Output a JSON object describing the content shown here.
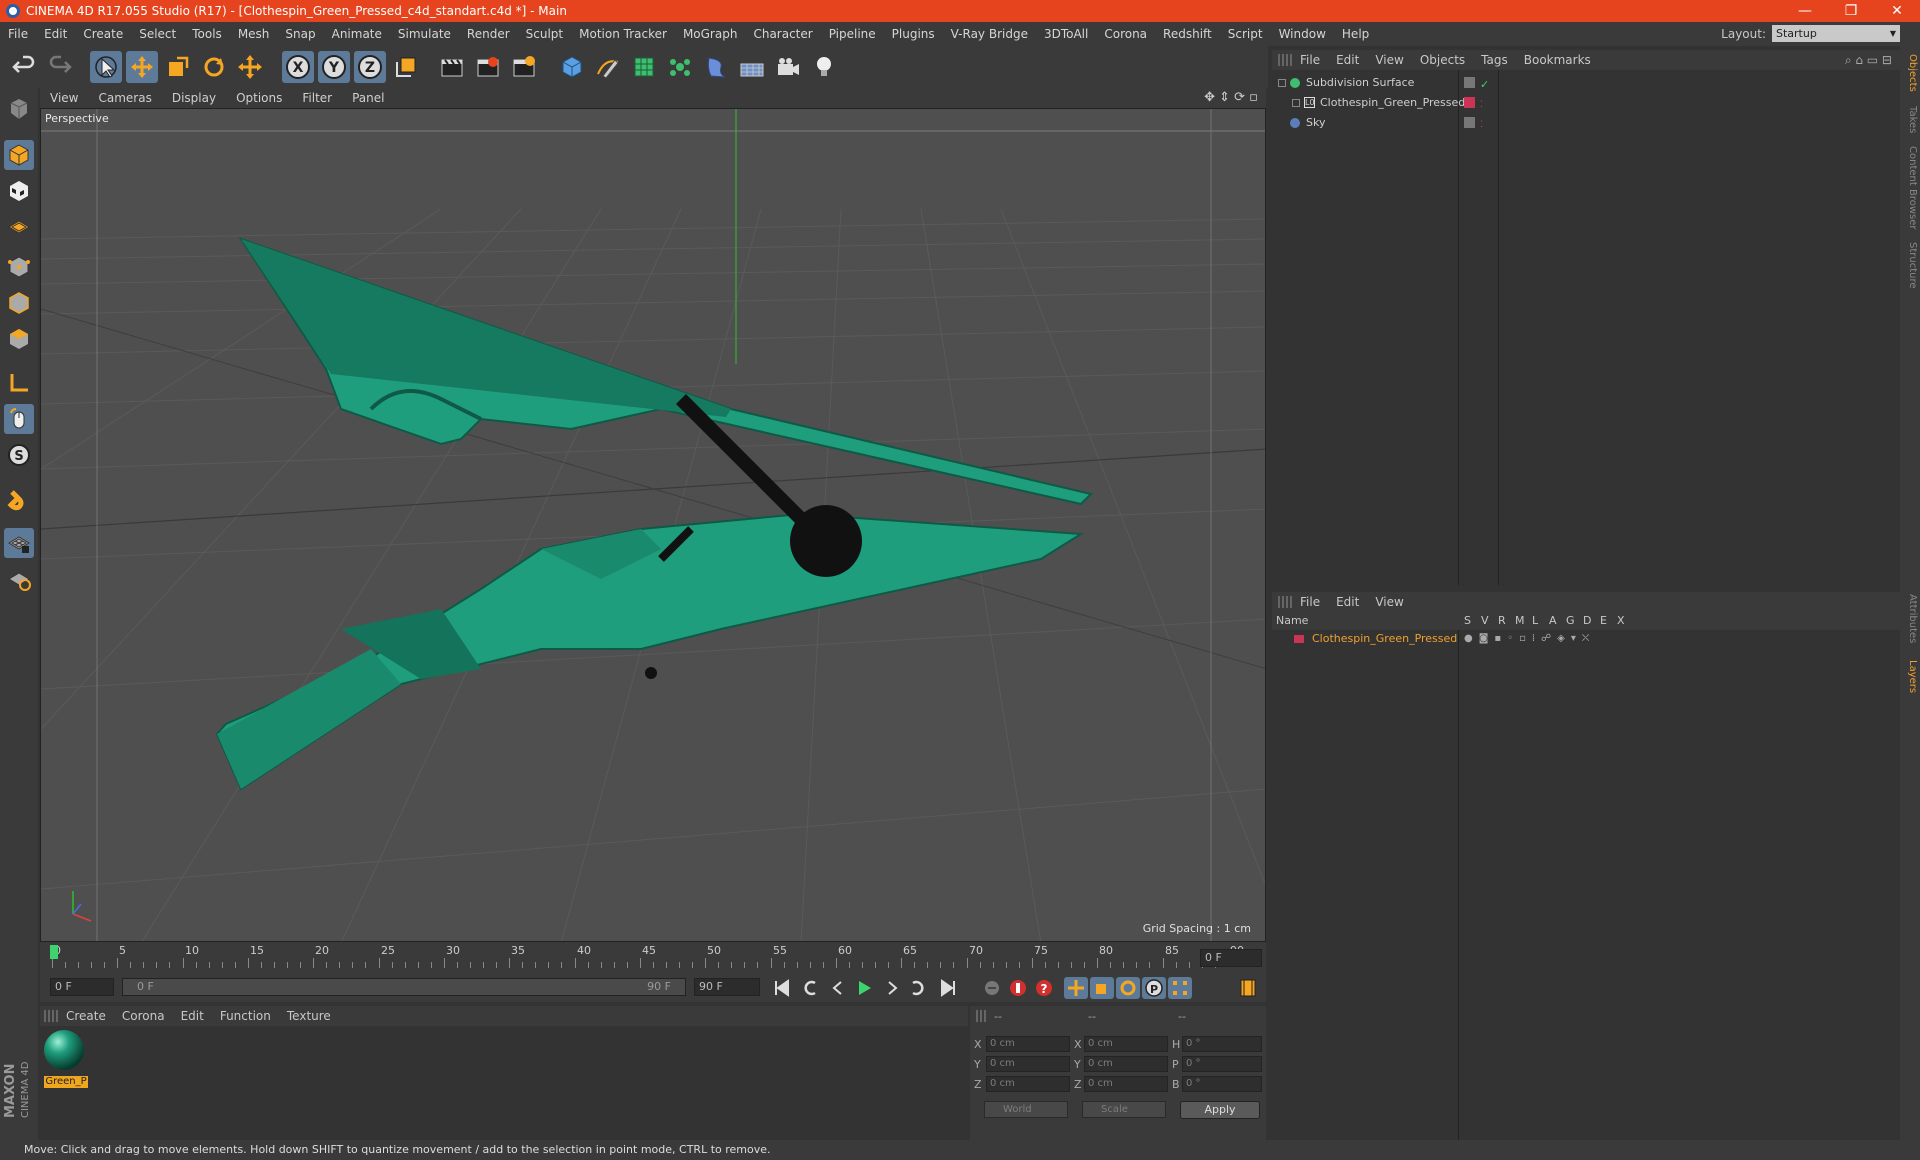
{
  "window": {
    "title": "CINEMA 4D R17.055 Studio (R17) - [Clothespin_Green_Pressed_c4d_standart.c4d *] - Main",
    "controls": [
      "—",
      "❐",
      "✕"
    ]
  },
  "menu": [
    "File",
    "Edit",
    "Create",
    "Select",
    "Tools",
    "Mesh",
    "Snap",
    "Animate",
    "Simulate",
    "Render",
    "Sculpt",
    "Motion Tracker",
    "MoGraph",
    "Character",
    "Pipeline",
    "Plugins",
    "V-Ray Bridge",
    "3DToAll",
    "Corona",
    "Redshift",
    "Script",
    "Window",
    "Help"
  ],
  "layout": {
    "label": "Layout:",
    "value": "Startup"
  },
  "toolbar": {
    "icons": [
      "undo-icon",
      "redo-icon",
      "select-cursor-icon",
      "move-icon",
      "scale-icon",
      "rotate-icon",
      "live-move-icon",
      "x-axis-icon",
      "y-axis-icon",
      "z-axis-icon",
      "coordinate-system-icon",
      "render-view-icon",
      "render-picture-viewer-icon",
      "edit-render-settings-icon",
      "cube-primitive-icon",
      "pen-spline-icon",
      "subdivision-surface-icon",
      "cloner-icon",
      "deformer-icon",
      "floor-icon",
      "camera-icon",
      "light-icon"
    ],
    "axis_labels": [
      "X",
      "Y",
      "Z"
    ]
  },
  "viewport": {
    "menu": [
      "View",
      "Cameras",
      "Display",
      "Options",
      "Filter",
      "Panel"
    ],
    "label": "Perspective",
    "grid_spacing": "Grid Spacing : 1 cm"
  },
  "timeline": {
    "ticks": [
      "0",
      "5",
      "10",
      "15",
      "20",
      "25",
      "30",
      "35",
      "40",
      "45",
      "50",
      "55",
      "60",
      "65",
      "70",
      "75",
      "80",
      "85",
      "90"
    ],
    "current_frame": "0 F",
    "start_field": "0 F",
    "range_start": "0 F",
    "range_end": "90 F",
    "end_field": "90 F"
  },
  "material_manager": {
    "menu": [
      "Create",
      "Corona",
      "Edit",
      "Function",
      "Texture"
    ],
    "materials": [
      {
        "label": "Green_P",
        "color": "#1f9e7e"
      }
    ]
  },
  "coordinates": {
    "headers": [
      "--",
      "--",
      "--"
    ],
    "rows": [
      {
        "a": "X",
        "av": "0 cm",
        "b": "X",
        "bv": "0 cm",
        "c": "H",
        "cv": "0 °"
      },
      {
        "a": "Y",
        "av": "0 cm",
        "b": "Y",
        "bv": "0 cm",
        "c": "P",
        "cv": "0 °"
      },
      {
        "a": "Z",
        "av": "0 cm",
        "b": "Z",
        "bv": "0 cm",
        "c": "B",
        "cv": "0 °"
      }
    ],
    "mode": "World",
    "transform": "Scale",
    "apply": "Apply"
  },
  "object_manager": {
    "menu": [
      "File",
      "Edit",
      "View",
      "Objects",
      "Tags",
      "Bookmarks"
    ],
    "objects": [
      {
        "name": "Subdivision Surface",
        "indent": 0,
        "icon": "subdivision-surface-icon",
        "color": "#cfcfcf"
      },
      {
        "name": "Clothespin_Green_Pressed",
        "indent": 1,
        "icon": "null-object-icon",
        "color": "#cfcfcf",
        "tag_color": "#cc3355"
      },
      {
        "name": "Sky",
        "indent": 0,
        "icon": "sky-icon",
        "color": "#cfcfcf"
      }
    ]
  },
  "layer_manager": {
    "menu": [
      "File",
      "Edit",
      "View"
    ],
    "columns": [
      "Name",
      "S",
      "V",
      "R",
      "M",
      "L",
      "A",
      "G",
      "D",
      "E",
      "X"
    ],
    "layers": [
      {
        "name": "Clothespin_Green_Pressed",
        "color": "#f0a030",
        "swatch": "#cc3355"
      }
    ]
  },
  "right_tabs": [
    "Objects",
    "Takes",
    "Content Browser",
    "Structure",
    "Attributes",
    "Layers"
  ],
  "status": "Move: Click and drag to move elements. Hold down SHIFT to quantize movement / add to the selection in point mode, CTRL to remove.",
  "brand": {
    "maxon": "MAXON",
    "product": "CINEMA 4D"
  },
  "colors": {
    "accent": "#e6441e",
    "highlight": "#5e7a99",
    "model": "#1f9e7e"
  }
}
